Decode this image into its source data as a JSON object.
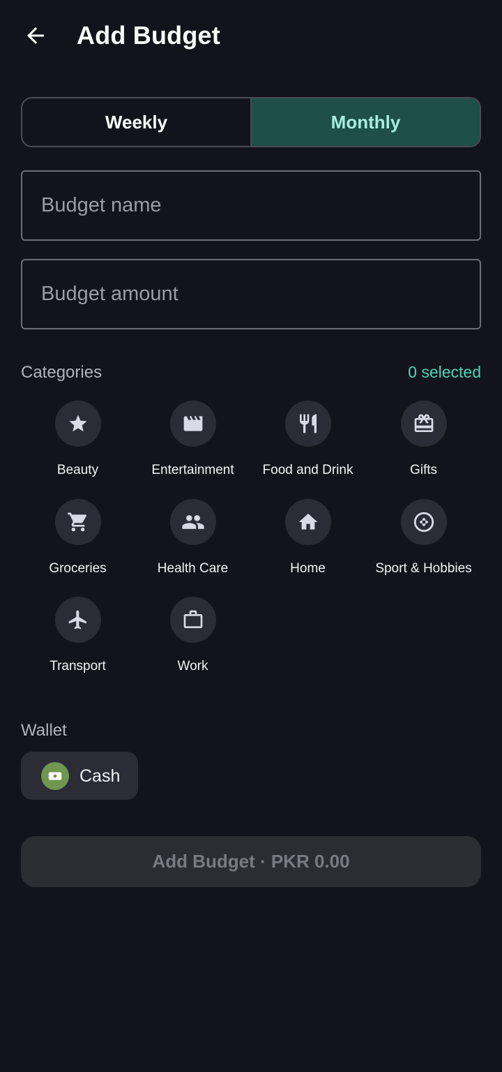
{
  "header": {
    "title": "Add Budget",
    "back_icon": "arrow-left-icon"
  },
  "period_toggle": {
    "options": [
      "Weekly",
      "Monthly"
    ],
    "selected": "Monthly"
  },
  "fields": {
    "name_placeholder": "Budget name",
    "amount_placeholder": "Budget amount"
  },
  "categories": {
    "label": "Categories",
    "selected_text": "0 selected",
    "items": [
      {
        "label": "Beauty",
        "icon": "star-icon"
      },
      {
        "label": "Entertainment",
        "icon": "clapperboard-icon"
      },
      {
        "label": "Food and Drink",
        "icon": "fork-knife-icon"
      },
      {
        "label": "Gifts",
        "icon": "gift-card-icon"
      },
      {
        "label": "Groceries",
        "icon": "shopping-cart-icon"
      },
      {
        "label": "Health Care",
        "icon": "people-icon"
      },
      {
        "label": "Home",
        "icon": "home-icon"
      },
      {
        "label": "Sport & Hobbies",
        "icon": "gamepad-icon"
      },
      {
        "label": "Transport",
        "icon": "airplane-icon"
      },
      {
        "label": "Work",
        "icon": "briefcase-icon"
      }
    ]
  },
  "wallet": {
    "label": "Wallet",
    "selected_name": "Cash",
    "icon": "cash-icon",
    "icon_color": "#6f974f"
  },
  "submit": {
    "label": "Add Budget · PKR 0.00"
  },
  "colors": {
    "background": "#13141b",
    "accent": "#4cd3b9",
    "selected_toggle_bg": "#1e4f49",
    "icon_circle": "#2b2c36"
  }
}
